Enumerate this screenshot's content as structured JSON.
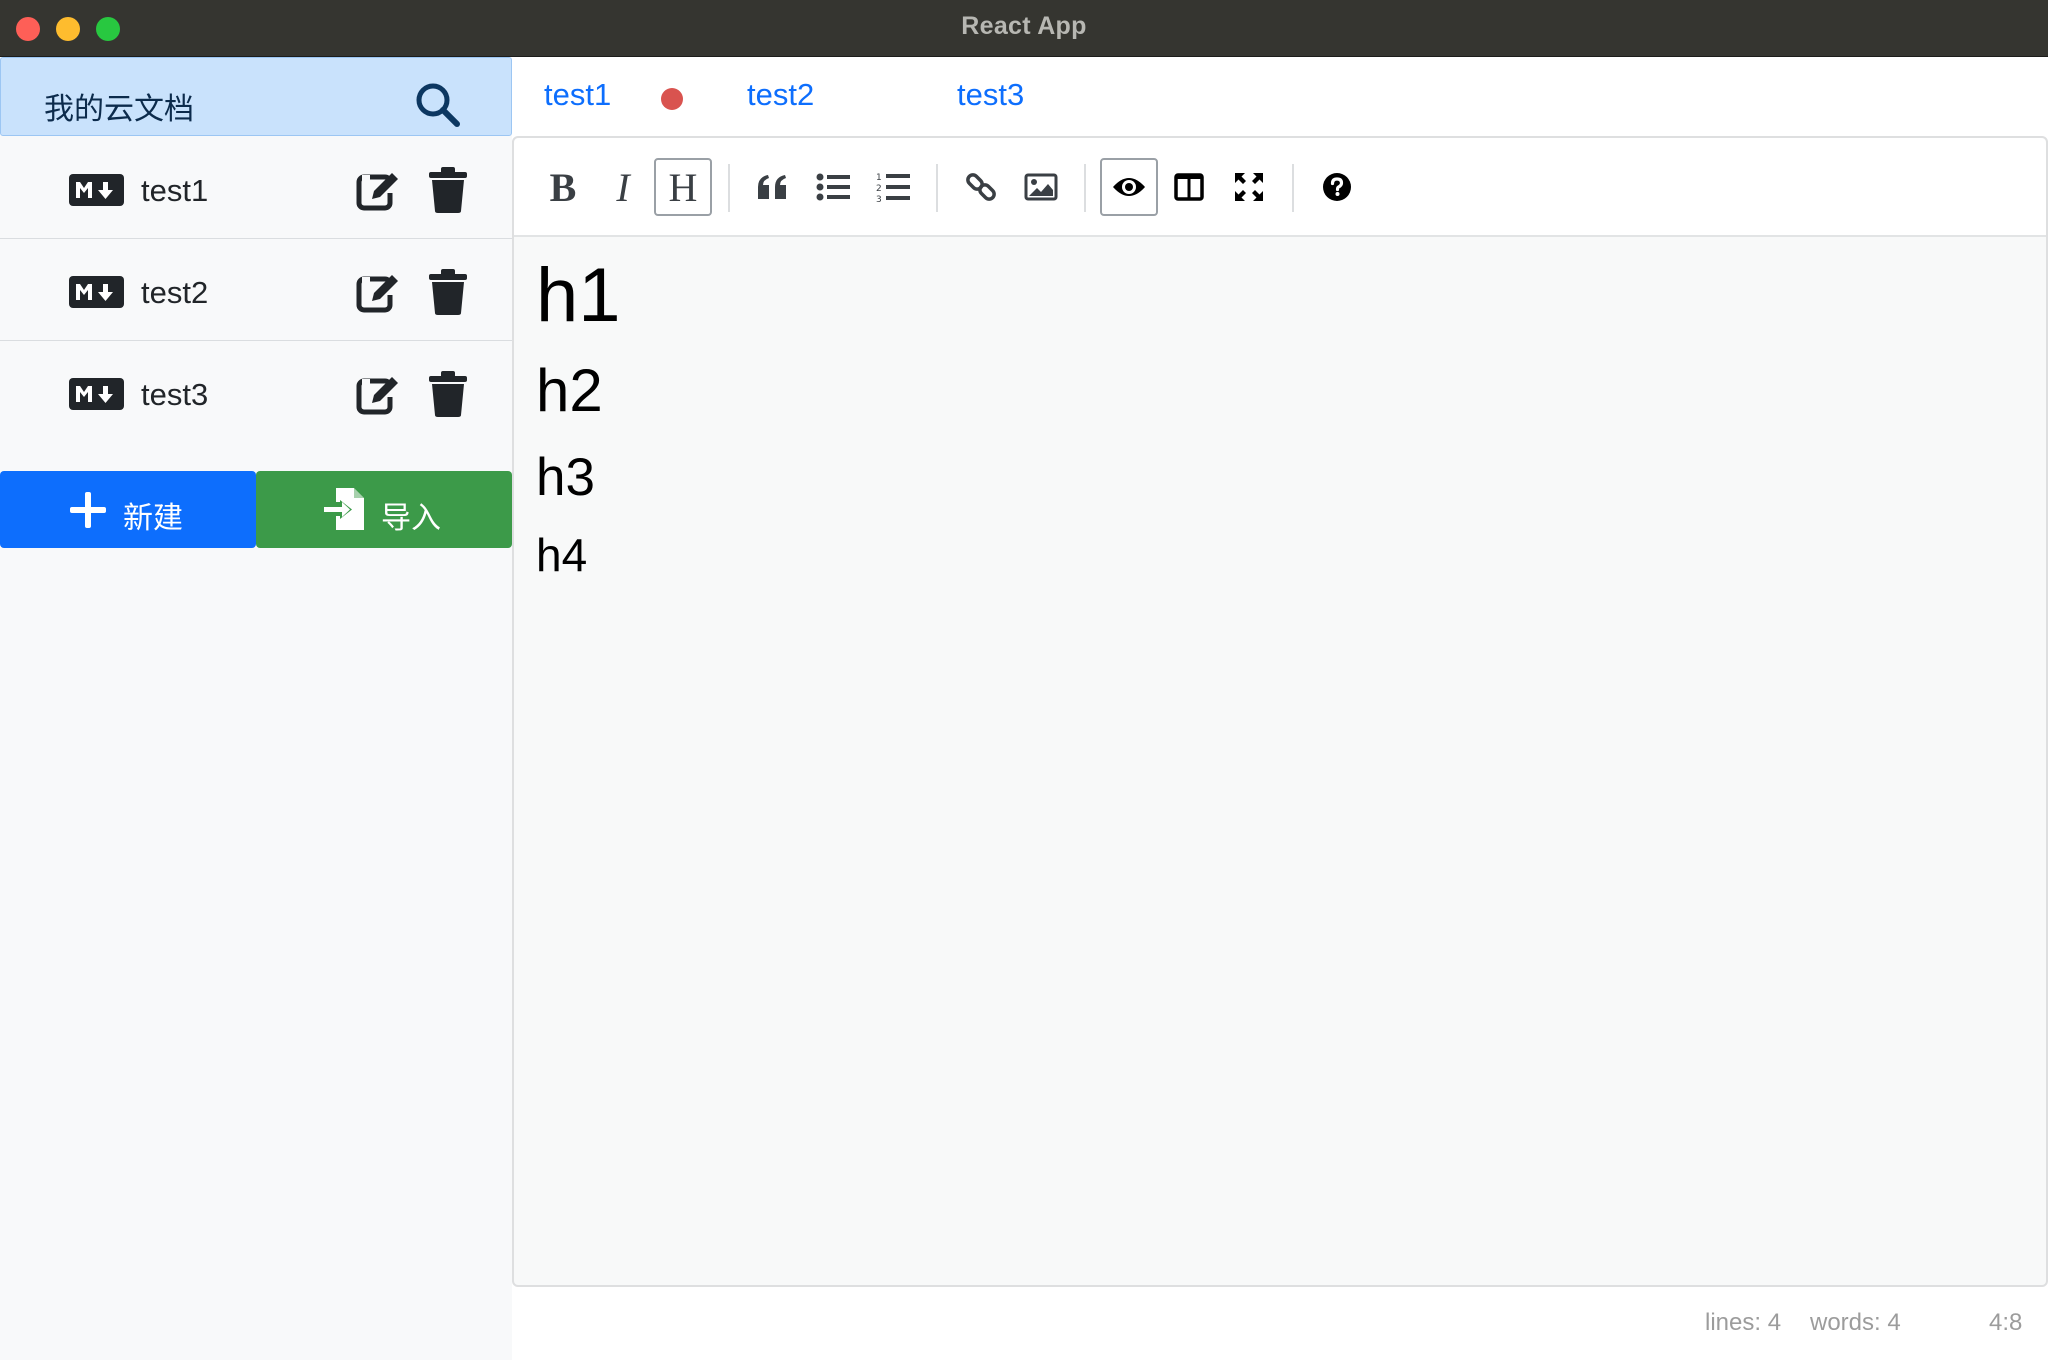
{
  "window": {
    "title": "React App"
  },
  "sidebar": {
    "title": "我的云文档",
    "search_icon": "search-icon",
    "files": [
      {
        "name": "test1",
        "icon": "markdown-icon"
      },
      {
        "name": "test2",
        "icon": "markdown-icon"
      },
      {
        "name": "test3",
        "icon": "markdown-icon"
      }
    ],
    "new_label": "新建",
    "import_label": "导入"
  },
  "tabs": {
    "items": [
      {
        "label": "test1",
        "unsaved": true
      },
      {
        "label": "test2",
        "unsaved": false
      },
      {
        "label": "test3",
        "unsaved": false
      }
    ],
    "active": "test1"
  },
  "toolbar": {
    "bold": "B",
    "italic": "I",
    "heading": "H",
    "active_tools": [
      "heading",
      "preview"
    ]
  },
  "editor": {
    "lines": [
      "h1",
      "h2",
      "h3",
      "h4"
    ]
  },
  "status": {
    "lines": "lines: 4",
    "words": "words: 4",
    "cursor": "4:8"
  },
  "colors": {
    "primary": "#0d6efd",
    "success": "#3c9a49",
    "unsaved_dot": "#d9534f",
    "search_bar": "#c9e2fc"
  }
}
